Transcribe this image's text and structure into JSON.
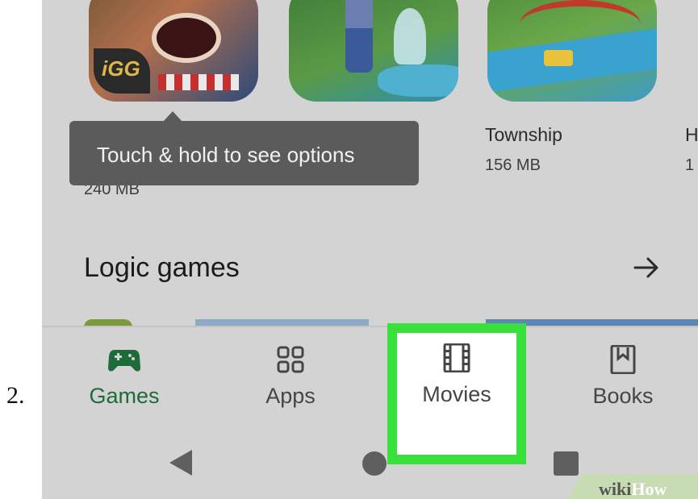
{
  "step": {
    "number": "2."
  },
  "apps_row": [
    {
      "name": "",
      "size": "240 MB"
    },
    {
      "name": "",
      "size": ""
    },
    {
      "name": "Township",
      "size": "156 MB"
    },
    {
      "name": "H",
      "size": "1"
    }
  ],
  "tooltip": {
    "text": "Touch & hold to see options"
  },
  "section": {
    "title": "Logic games",
    "more_icon": "arrow-right-icon"
  },
  "bottom_nav": {
    "items": [
      {
        "label": "Games",
        "icon": "gamepad-icon",
        "active": true,
        "color": "#1e6b3a"
      },
      {
        "label": "Apps",
        "icon": "apps-grid-icon",
        "active": false
      },
      {
        "label": "Movies",
        "icon": "film-icon",
        "active": false,
        "highlighted": true
      },
      {
        "label": "Books",
        "icon": "bookmark-book-icon",
        "active": false
      }
    ]
  },
  "system_nav": [
    "back-icon",
    "home-icon",
    "recents-icon"
  ],
  "highlight_color": "#39e03a",
  "watermark": {
    "part1": "wiki",
    "part2": "How"
  }
}
